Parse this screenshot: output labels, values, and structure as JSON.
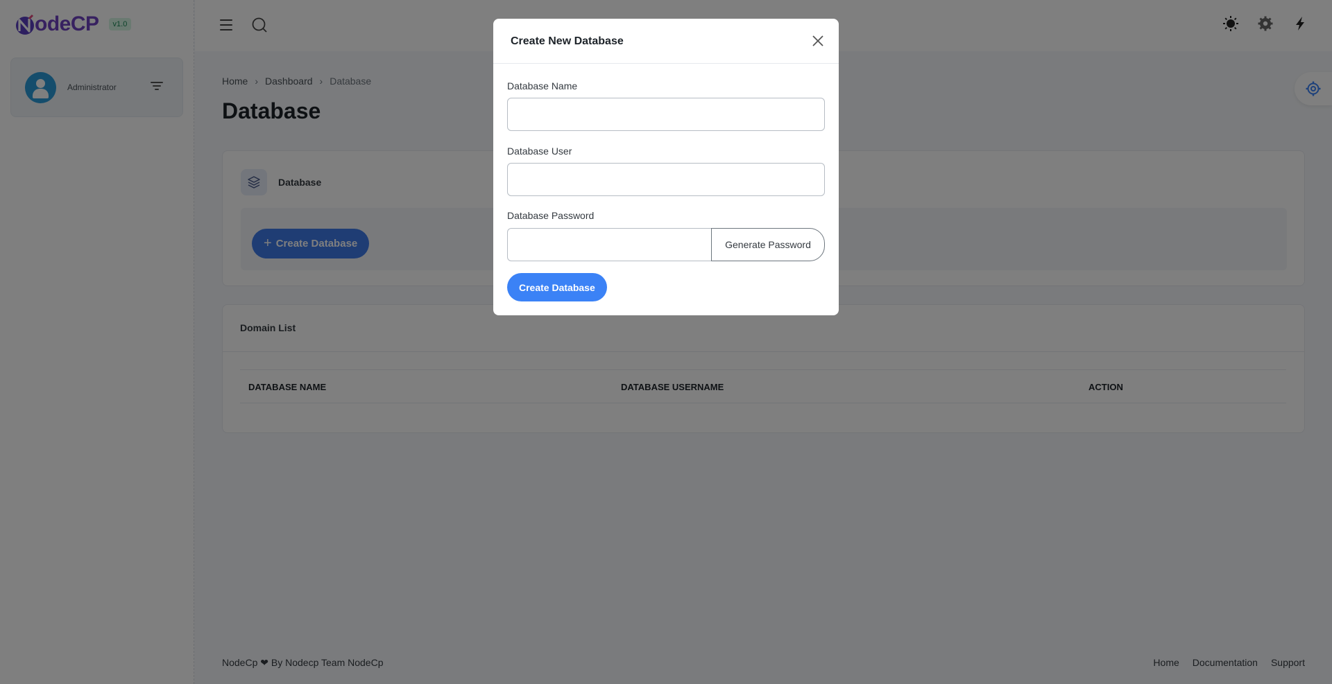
{
  "app": {
    "logo_text": "odeCP",
    "logo_letter": "N",
    "version": "v1.0"
  },
  "sidebar": {
    "user_name": "Administrator"
  },
  "breadcrumb": {
    "items": [
      "Home",
      "Dashboard",
      "Database"
    ],
    "separator": "›"
  },
  "page": {
    "title": "Database"
  },
  "database_card": {
    "title": "Database",
    "create_button": "Create Database",
    "create_icon": "+"
  },
  "domain_list": {
    "title": "Domain List",
    "columns": [
      "DATABASE NAME",
      "DATABASE USERNAME",
      "ACTION"
    ]
  },
  "footer": {
    "left": "NodeCp ❤ By Nodecp Team NodeCp",
    "links": [
      "Home",
      "Documentation",
      "Support"
    ]
  },
  "modal": {
    "title": "Create New Database",
    "fields": {
      "db_name_label": "Database Name",
      "db_name_value": "",
      "db_user_label": "Database User",
      "db_user_value": "",
      "db_password_label": "Database Password",
      "db_password_value": ""
    },
    "generate_password_label": "Generate Password",
    "submit_label": "Create Database"
  },
  "colors": {
    "brand": "#6f42c1",
    "primary": "#3b82f6",
    "overlay": "rgba(0,0,0,0.5)"
  },
  "icons": {
    "header": [
      "menu-icon",
      "search-icon",
      "sun-icon",
      "gear-icon",
      "lightning-icon"
    ],
    "sidebar": [
      "filter-icon"
    ],
    "card": [
      "layers-icon"
    ],
    "modal": [
      "close-icon"
    ]
  }
}
